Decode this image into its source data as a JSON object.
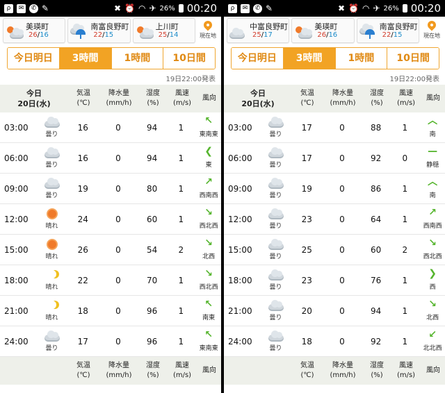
{
  "status": {
    "time": "00:20",
    "battery": "26%"
  },
  "left": {
    "cities": [
      {
        "name": "美瑛町",
        "hi": "26",
        "lo": "16",
        "icon": "sun-cloud"
      },
      {
        "name": "南富良野町",
        "hi": "22",
        "lo": "15",
        "icon": "rain"
      },
      {
        "name": "上川町",
        "hi": "25",
        "lo": "14",
        "icon": "sun-cloud"
      }
    ],
    "location_label": "現在地",
    "tabs": [
      "今日明日",
      "3時間",
      "1時間",
      "10日間"
    ],
    "issued": "19日22:00発表",
    "header": {
      "date1": "今日",
      "date2": "20日(水)",
      "temp": "気温",
      "temp_u": "(℃)",
      "precip": "降水量",
      "precip_u": "(mm/h)",
      "hum": "湿度",
      "hum_u": "(%)",
      "wind": "風速",
      "wind_u": "(m/s)",
      "dir": "風向"
    },
    "rows": [
      {
        "time": "03:00",
        "weather": "曇り",
        "icon": "cloud",
        "temp": "16",
        "precip": "0",
        "hum": "94",
        "wind": "1",
        "dir": "東南東",
        "arrow": "↖"
      },
      {
        "time": "06:00",
        "weather": "曇り",
        "icon": "cloud",
        "temp": "16",
        "precip": "0",
        "hum": "94",
        "wind": "1",
        "dir": "東",
        "arrow": "❮"
      },
      {
        "time": "09:00",
        "weather": "曇り",
        "icon": "cloud",
        "temp": "19",
        "precip": "0",
        "hum": "80",
        "wind": "1",
        "dir": "西南西",
        "arrow": "↗"
      },
      {
        "time": "12:00",
        "weather": "晴れ",
        "icon": "sun",
        "temp": "24",
        "precip": "0",
        "hum": "60",
        "wind": "1",
        "dir": "西北西",
        "arrow": "↘"
      },
      {
        "time": "15:00",
        "weather": "晴れ",
        "icon": "sun",
        "temp": "26",
        "precip": "0",
        "hum": "54",
        "wind": "2",
        "dir": "北西",
        "arrow": "↘"
      },
      {
        "time": "18:00",
        "weather": "晴れ",
        "icon": "moon",
        "temp": "22",
        "precip": "0",
        "hum": "70",
        "wind": "1",
        "dir": "西北西",
        "arrow": "↘"
      },
      {
        "time": "21:00",
        "weather": "晴れ",
        "icon": "moon",
        "temp": "18",
        "precip": "0",
        "hum": "96",
        "wind": "1",
        "dir": "南東",
        "arrow": "↖"
      },
      {
        "time": "24:00",
        "weather": "曇り",
        "icon": "cloud",
        "temp": "17",
        "precip": "0",
        "hum": "96",
        "wind": "1",
        "dir": "東南東",
        "arrow": "↖"
      }
    ]
  },
  "right": {
    "cities": [
      {
        "name": "中富良野町",
        "hi": "25",
        "lo": "17",
        "icon": "cloud"
      },
      {
        "name": "美瑛町",
        "hi": "26",
        "lo": "16",
        "icon": "sun-cloud"
      },
      {
        "name": "南富良野町",
        "hi": "22",
        "lo": "15",
        "icon": "rain"
      }
    ],
    "location_label": "現在地",
    "tabs": [
      "今日明日",
      "3時間",
      "1時間",
      "10日間"
    ],
    "issued": "19日22:00発表",
    "header": {
      "date1": "今日",
      "date2": "20日(水)",
      "temp": "気温",
      "temp_u": "(℃)",
      "precip": "降水量",
      "precip_u": "(mm/h)",
      "hum": "湿度",
      "hum_u": "(%)",
      "wind": "風速",
      "wind_u": "(m/s)",
      "dir": "風向"
    },
    "rows": [
      {
        "time": "03:00",
        "weather": "曇り",
        "icon": "cloud",
        "temp": "17",
        "precip": "0",
        "hum": "88",
        "wind": "1",
        "dir": "南",
        "arrow": "︿"
      },
      {
        "time": "06:00",
        "weather": "曇り",
        "icon": "cloud",
        "temp": "17",
        "precip": "0",
        "hum": "92",
        "wind": "0",
        "dir": "静穏",
        "arrow": "—"
      },
      {
        "time": "09:00",
        "weather": "曇り",
        "icon": "cloud",
        "temp": "19",
        "precip": "0",
        "hum": "86",
        "wind": "1",
        "dir": "南",
        "arrow": "︿"
      },
      {
        "time": "12:00",
        "weather": "曇り",
        "icon": "cloud",
        "temp": "23",
        "precip": "0",
        "hum": "64",
        "wind": "1",
        "dir": "西南西",
        "arrow": "↗"
      },
      {
        "time": "15:00",
        "weather": "曇り",
        "icon": "cloud",
        "temp": "25",
        "precip": "0",
        "hum": "60",
        "wind": "2",
        "dir": "西北西",
        "arrow": "↘"
      },
      {
        "time": "18:00",
        "weather": "曇り",
        "icon": "cloud",
        "temp": "23",
        "precip": "0",
        "hum": "76",
        "wind": "1",
        "dir": "西",
        "arrow": "❯"
      },
      {
        "time": "21:00",
        "weather": "曇り",
        "icon": "cloud",
        "temp": "20",
        "precip": "0",
        "hum": "94",
        "wind": "1",
        "dir": "北西",
        "arrow": "↘"
      },
      {
        "time": "24:00",
        "weather": "曇り",
        "icon": "cloud",
        "temp": "18",
        "precip": "0",
        "hum": "92",
        "wind": "1",
        "dir": "北北西",
        "arrow": "↙"
      }
    ]
  }
}
